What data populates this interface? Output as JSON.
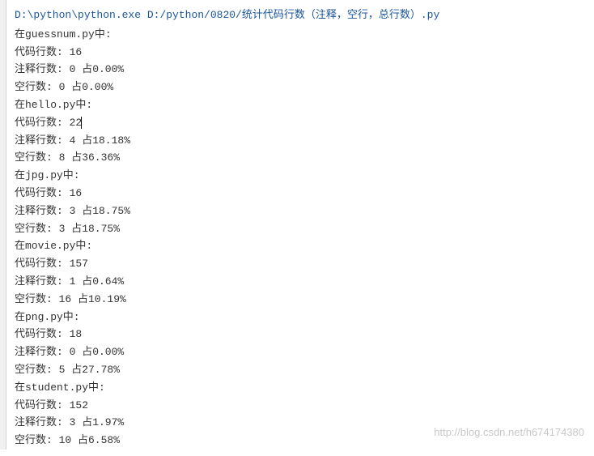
{
  "header": {
    "interpreter_path": "D:\\python\\python.exe",
    "script_path": "D:/python/0820/统计代码行数（注释，空行，总行数）.py"
  },
  "files": [
    {
      "name": "guessnum.py",
      "in_label_pre": "在",
      "in_label_post": "中:",
      "code_label": "代码行数:",
      "code_count": "  16",
      "comment_label": "注释行数:",
      "comment_count": "0",
      "comment_pct_label": "占",
      "comment_pct": "0.00%",
      "blank_label": "空行数:",
      "blank_count": "0",
      "blank_pct_label": "占",
      "blank_pct": "0.00%",
      "has_cursor": false
    },
    {
      "name": "hello.py",
      "in_label_pre": "在",
      "in_label_post": "中:",
      "code_label": "代码行数:",
      "code_count": "  22",
      "comment_label": "注释行数:",
      "comment_count": "4",
      "comment_pct_label": "占",
      "comment_pct": "18.18%",
      "blank_label": "空行数:",
      "blank_count": "8",
      "blank_pct_label": "占",
      "blank_pct": "36.36%",
      "has_cursor": true
    },
    {
      "name": "jpg.py",
      "in_label_pre": "在",
      "in_label_post": "中:",
      "code_label": "代码行数:",
      "code_count": "  16",
      "comment_label": "注释行数:",
      "comment_count": "3",
      "comment_pct_label": "占",
      "comment_pct": "18.75%",
      "blank_label": "空行数:",
      "blank_count": "3",
      "blank_pct_label": "占",
      "blank_pct": "18.75%",
      "has_cursor": false
    },
    {
      "name": "movie.py",
      "in_label_pre": "在",
      "in_label_post": "中:",
      "code_label": "代码行数:",
      "code_count": "  157",
      "comment_label": "注释行数:",
      "comment_count": "1",
      "comment_pct_label": "占",
      "comment_pct": "0.64%",
      "blank_label": "空行数:",
      "blank_count": "16",
      "blank_pct_label": "占",
      "blank_pct": "10.19%",
      "has_cursor": false
    },
    {
      "name": "png.py",
      "in_label_pre": "在",
      "in_label_post": "中:",
      "code_label": "代码行数:",
      "code_count": "  18",
      "comment_label": "注释行数:",
      "comment_count": "0",
      "comment_pct_label": "占",
      "comment_pct": "0.00%",
      "blank_label": "空行数:",
      "blank_count": "5",
      "blank_pct_label": "占",
      "blank_pct": "27.78%",
      "has_cursor": false
    },
    {
      "name": "student.py",
      "in_label_pre": "在",
      "in_label_post": "中:",
      "code_label": "代码行数:",
      "code_count": "  152",
      "comment_label": "注释行数:",
      "comment_count": "3",
      "comment_pct_label": "占",
      "comment_pct": "1.97%",
      "blank_label": "空行数:",
      "blank_count": "10",
      "blank_pct_label": "占",
      "blank_pct": "6.58%",
      "has_cursor": false
    }
  ],
  "watermark": "http://blog.csdn.net/h674174380"
}
